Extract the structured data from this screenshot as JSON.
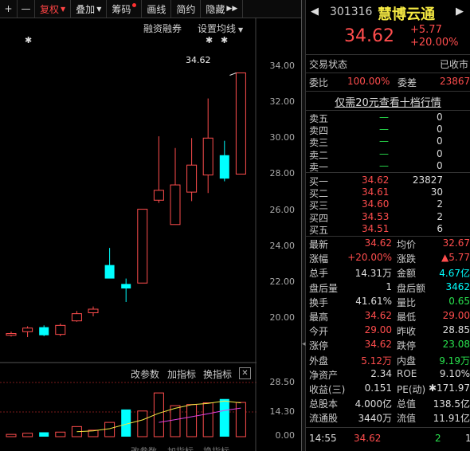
{
  "toolbar": {
    "plus": "+",
    "minus": "—",
    "fuquan": "复权",
    "diejia": "叠加",
    "chouma": "筹码",
    "huaxian": "画线",
    "jianyue": "简约",
    "yincang": "隐藏",
    "more": "▶▶"
  },
  "chart": {
    "overlay_right_a": "融资融券",
    "overlay_right_b": "设置均线",
    "peak_label": "34.62",
    "star": "✱",
    "price_ticks": [
      "34.00",
      "32.00",
      "30.00",
      "28.00",
      "26.00",
      "24.00",
      "22.00",
      "20.00"
    ],
    "indicator_bar": [
      "改参数",
      "加指标",
      "换指标"
    ],
    "close_x": "✕",
    "vol_ticks": [
      "28.50",
      "14.30",
      "0.00"
    ],
    "bottom_cut": [
      "改参数",
      "加指标",
      "换指标"
    ]
  },
  "chart_data": {
    "type": "candlestick",
    "candles": [
      {
        "o": 20.15,
        "h": 20.25,
        "l": 19.98,
        "c": 20.05,
        "dir": "up"
      },
      {
        "o": 20.25,
        "h": 20.55,
        "l": 19.95,
        "c": 20.45,
        "dir": "up"
      },
      {
        "o": 20.5,
        "h": 20.6,
        "l": 20.0,
        "c": 20.05,
        "dir": "down"
      },
      {
        "o": 20.1,
        "h": 20.7,
        "l": 20.0,
        "c": 20.6,
        "dir": "up"
      },
      {
        "o": 20.85,
        "h": 21.4,
        "l": 20.8,
        "c": 21.25,
        "dir": "up"
      },
      {
        "o": 21.3,
        "h": 21.65,
        "l": 21.1,
        "c": 21.5,
        "dir": "up"
      },
      {
        "o": 23.95,
        "h": 24.9,
        "l": 23.35,
        "c": 23.2,
        "dir": "down"
      },
      {
        "o": 22.9,
        "h": 23.2,
        "l": 21.9,
        "c": 22.65,
        "dir": "down"
      },
      {
        "o": 22.95,
        "h": 27.05,
        "l": 22.95,
        "c": 27.05,
        "dir": "up"
      },
      {
        "o": 27.55,
        "h": 31.1,
        "l": 27.4,
        "c": 28.1,
        "dir": "up"
      },
      {
        "o": 26.2,
        "h": 30.45,
        "l": 26.2,
        "c": 28.4,
        "dir": "up"
      },
      {
        "o": 28.0,
        "h": 31.0,
        "l": 27.5,
        "c": 29.5,
        "dir": "up"
      },
      {
        "o": 28.95,
        "h": 33.2,
        "l": 27.95,
        "c": 31.0,
        "dir": "up"
      },
      {
        "o": 30.05,
        "h": 30.85,
        "l": 28.6,
        "c": 28.75,
        "dir": "down"
      },
      {
        "o": 29.0,
        "h": 34.62,
        "l": 29.0,
        "c": 34.62,
        "dir": "up"
      }
    ],
    "volume": [
      {
        "v": 1.2,
        "dir": "up"
      },
      {
        "v": 1.8,
        "dir": "up"
      },
      {
        "v": 2.3,
        "dir": "down"
      },
      {
        "v": 2.4,
        "dir": "up"
      },
      {
        "v": 5.3,
        "dir": "up"
      },
      {
        "v": 3.4,
        "dir": "up"
      },
      {
        "v": 7.5,
        "dir": "up"
      },
      {
        "v": 14.3,
        "dir": "down"
      },
      {
        "v": 13.5,
        "dir": "up"
      },
      {
        "v": 23.0,
        "dir": "up"
      },
      {
        "v": 16.3,
        "dir": "up"
      },
      {
        "v": 16.9,
        "dir": "up"
      },
      {
        "v": 17.8,
        "dir": "up"
      },
      {
        "v": 19.8,
        "dir": "down"
      },
      {
        "v": 18.0,
        "dir": "up"
      }
    ],
    "vol_ylim": [
      0,
      28.5
    ],
    "ylim": [
      19.4,
      35.0
    ]
  },
  "quote": {
    "code": "301316",
    "name": "慧博云通",
    "price": "34.62",
    "change": "+5.77",
    "pct": "+20.00%",
    "status_label": "交易状态",
    "status_value": "已收市",
    "weibi_label": "委比",
    "weibi_value": "100.00%",
    "weicha_label": "委差",
    "weicha_value": "23867",
    "promo": "仅需20元查看十档行情",
    "sells": [
      {
        "label": "卖五",
        "price": "—",
        "vol": "0"
      },
      {
        "label": "卖四",
        "price": "—",
        "vol": "0"
      },
      {
        "label": "卖三",
        "price": "—",
        "vol": "0"
      },
      {
        "label": "卖二",
        "price": "—",
        "vol": "0"
      },
      {
        "label": "卖一",
        "price": "—",
        "vol": "0"
      }
    ],
    "buys": [
      {
        "label": "买一",
        "price": "34.62",
        "vol": "23827"
      },
      {
        "label": "买二",
        "price": "34.61",
        "vol": "30"
      },
      {
        "label": "买三",
        "price": "34.60",
        "vol": "2"
      },
      {
        "label": "买四",
        "price": "34.53",
        "vol": "2"
      },
      {
        "label": "买五",
        "price": "34.51",
        "vol": "6"
      }
    ],
    "stats": [
      {
        "l1": "最新",
        "v1": "34.62",
        "c1": "red",
        "l2": "均价",
        "v2": "32.67",
        "c2": "red"
      },
      {
        "l1": "涨幅",
        "v1": "+20.00%",
        "c1": "red",
        "l2": "涨跌",
        "v2": "▲5.77",
        "c2": "red"
      },
      {
        "l1": "总手",
        "v1": "14.31万",
        "c1": "white",
        "l2": "金额",
        "v2": "4.67亿",
        "c2": "cyan"
      },
      {
        "l1": "盘后量",
        "v1": "1",
        "c1": "white",
        "l2": "盘后额",
        "v2": "3462",
        "c2": "cyan"
      },
      {
        "l1": "换手",
        "v1": "41.61%",
        "c1": "white",
        "l2": "量比",
        "v2": "0.65",
        "c2": "green"
      },
      {
        "l1": "最高",
        "v1": "34.62",
        "c1": "red",
        "l2": "最低",
        "v2": "29.00",
        "c2": "red"
      },
      {
        "l1": "今开",
        "v1": "29.00",
        "c1": "red",
        "l2": "昨收",
        "v2": "28.85",
        "c2": "white"
      },
      {
        "l1": "涨停",
        "v1": "34.62",
        "c1": "red",
        "l2": "跌停",
        "v2": "23.08",
        "c2": "green"
      },
      {
        "l1": "外盘",
        "v1": "5.12万",
        "c1": "red",
        "l2": "内盘",
        "v2": "9.19万",
        "c2": "green"
      },
      {
        "l1": "净资产",
        "v1": "2.34",
        "c1": "white",
        "l2": "ROE",
        "v2": "9.10%",
        "c2": "white"
      },
      {
        "l1": "收益(三)",
        "v1": "0.151",
        "c1": "white",
        "l2": "PE(动)",
        "v2": "✱171.97",
        "c2": "white"
      },
      {
        "l1": "总股本",
        "v1": "4.000亿",
        "c1": "white",
        "l2": "总值",
        "v2": "138.5亿",
        "c2": "white"
      },
      {
        "l1": "流通股",
        "v1": "3440万",
        "c1": "white",
        "l2": "流值",
        "v2": "11.91亿",
        "c2": "white"
      }
    ],
    "tick": {
      "time": "14:55",
      "price": "34.62",
      "vol": "2",
      "extra": "1"
    }
  }
}
